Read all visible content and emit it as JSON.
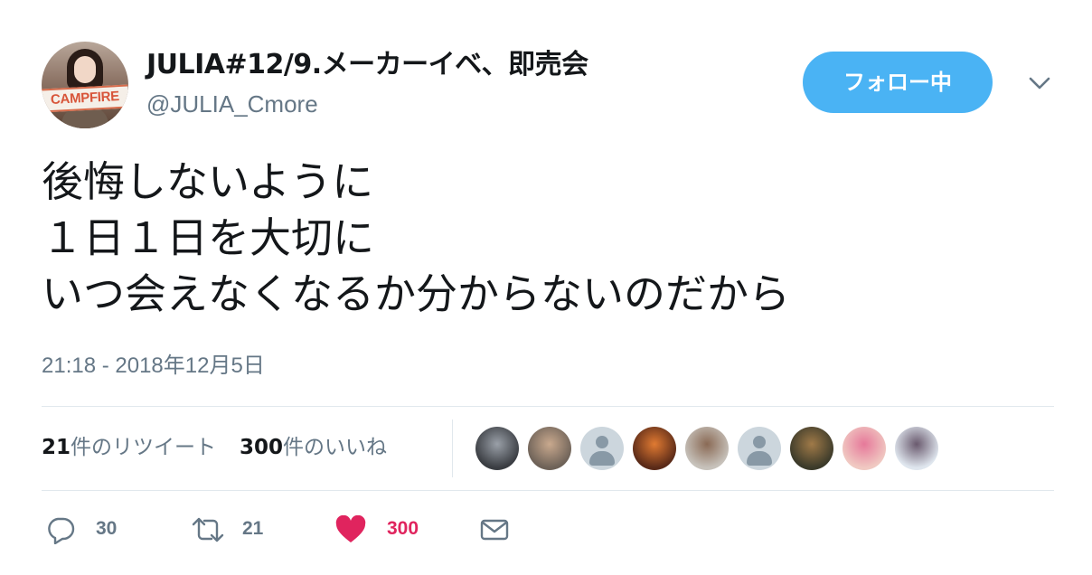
{
  "user": {
    "display_name": "JULIA#12/9.メーカーイベ、即売会",
    "handle": "@JULIA_Cmore",
    "avatar_sign_text": "CAMPFIRE"
  },
  "follow_button": {
    "label": "フォロー中",
    "color": "#4ab3f4"
  },
  "tweet": {
    "lines": [
      "後悔しないように",
      "１日１日を大切に",
      "いつ会えなくなるか分からないのだから"
    ],
    "timestamp": "21:18 - 2018年12月5日"
  },
  "stats": {
    "retweets_count": "21",
    "retweets_label": "件のリツイート",
    "likes_count": "300",
    "likes_label": "件のいいね"
  },
  "likers": [
    {
      "name": "liker-avatar-car",
      "color": "#3a3d42",
      "accent": "#9aa0a8"
    },
    {
      "name": "liker-avatar-group",
      "color": "#6e6258",
      "accent": "#c9a98e"
    },
    {
      "name": "liker-avatar-default",
      "default": true
    },
    {
      "name": "liker-avatar-donut",
      "color": "#5a2a18",
      "accent": "#e07a32"
    },
    {
      "name": "liker-avatar-man",
      "color": "#c7c2bb",
      "accent": "#8a6a55"
    },
    {
      "name": "liker-avatar-default-2",
      "default": true
    },
    {
      "name": "liker-avatar-art",
      "color": "#3b3a2a",
      "accent": "#a07a48"
    },
    {
      "name": "liker-avatar-woman",
      "color": "#f0c9c2",
      "accent": "#e6799a"
    },
    {
      "name": "liker-avatar-anime",
      "color": "#dfe6ee",
      "accent": "#6a5a6e"
    }
  ],
  "actions": {
    "reply_count": "30",
    "retweet_count": "21",
    "like_count": "300",
    "like_color": "#e0245e"
  }
}
